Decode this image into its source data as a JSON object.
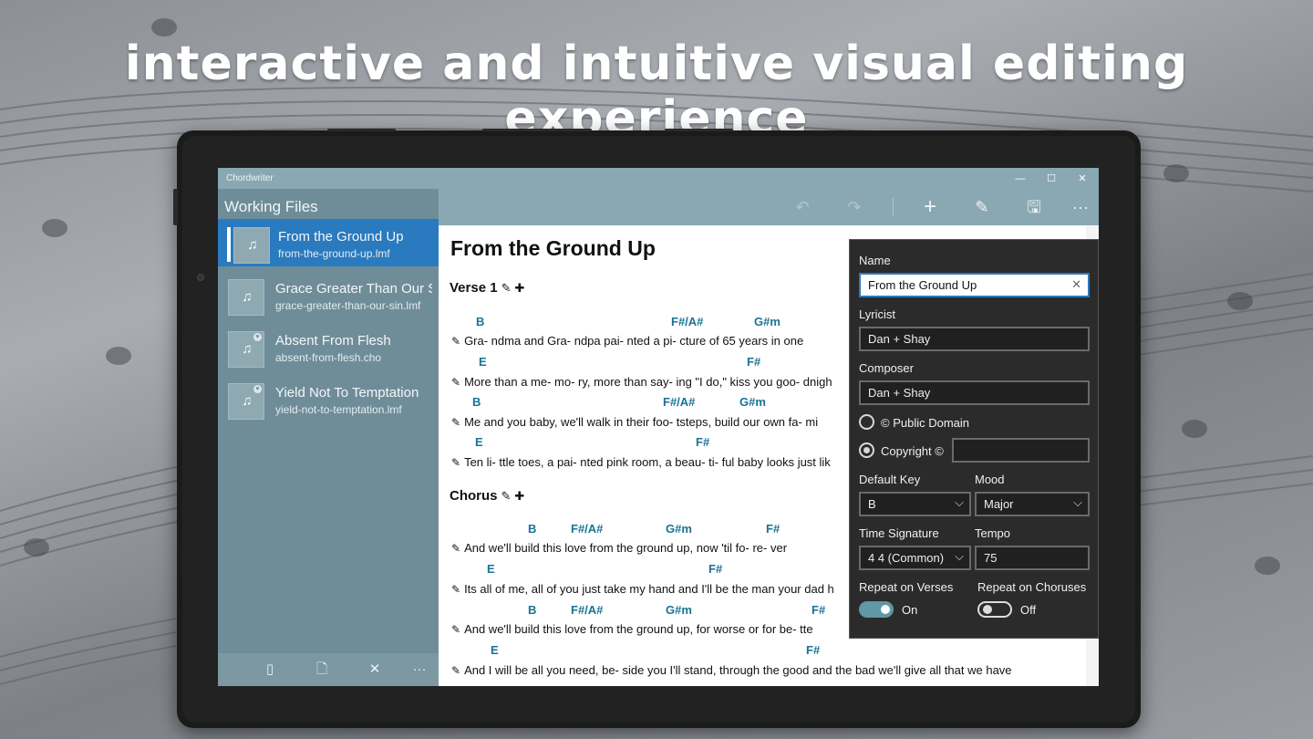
{
  "headline": "interactive and intuitive visual editing experience",
  "window": {
    "title": "Chordwriter",
    "minimize": "—",
    "maximize": "☐",
    "close": "✕"
  },
  "sidebar": {
    "title": "Working Files",
    "items": [
      {
        "name": "From the Ground Up",
        "path": "from-the-ground-up.lmf",
        "icon": "music-note-icon"
      },
      {
        "name": "Grace Greater Than Our Sin",
        "path": "grace-greater-than-our-sin.lmf",
        "icon": "music-note-icon"
      },
      {
        "name": "Absent From Flesh",
        "path": "absent-from-flesh.cho",
        "icon": "music-note-icon"
      },
      {
        "name": "Yield Not To Temptation",
        "path": "yield-not-to-temptation.lmf",
        "icon": "music-note-icon"
      }
    ],
    "bottom": {
      "new": "▯",
      "new_file": "🗋",
      "close": "✕",
      "more": "···"
    }
  },
  "toolbar": {
    "undo": "↶",
    "redo": "↷",
    "add": "+",
    "edit": "✎",
    "save": "🖫",
    "more": "···"
  },
  "song": {
    "title": "From the Ground Up",
    "sections": [
      {
        "name": "Verse 1",
        "edit": "✎",
        "add": "✚"
      },
      {
        "name": "Chorus",
        "edit": "✎",
        "add": "✚"
      }
    ],
    "lines": [
      {
        "chords": [
          "B",
          "F#/A#",
          "G#m"
        ],
        "lyric": "Gra- ndma and Gra- ndpa pai- nted a pi-       cture of 65        years in one"
      },
      {
        "chords": [
          "E",
          "F#"
        ],
        "lyric": "More than a me- mo- ry, more than say- ing \"I do,\" kiss you goo- dnigh"
      },
      {
        "chords": [
          "B",
          "F#/A#",
          "G#m"
        ],
        "lyric": "Me and you baby, we'll walk in their foo-       tsteps, build our own fa- mi"
      },
      {
        "chords": [
          "E",
          "F#"
        ],
        "lyric": "Ten li- ttle toes, a pai- nted pink room, a beau- ti- ful baby looks just lik"
      },
      {
        "chords": [
          "B",
          "F#/A#",
          "G#m",
          "F#"
        ],
        "lyric": "And we'll build this love       from the ground up, now 'til fo- re- ver"
      },
      {
        "chords": [
          "E",
          "F#"
        ],
        "lyric": "Its all of me, all of you just take my hand and I'll  be the man your dad h"
      },
      {
        "chords": [
          "B",
          "F#/A#",
          "G#m",
          "F#"
        ],
        "lyric": "And we'll build this love       from the ground up, for worse or for be- tte"
      },
      {
        "chords": [
          "E",
          "F#"
        ],
        "lyric": "And I  will be all you need, be- side you I'll stand, through the good and the bad we'll give all that we have"
      }
    ]
  },
  "properties": {
    "name_label": "Name",
    "name_value": "From the Ground Up",
    "clear": "✕",
    "lyricist_label": "Lyricist",
    "lyricist_value": "Dan + Shay",
    "composer_label": "Composer",
    "composer_value": "Dan + Shay",
    "public_domain": "© Public Domain",
    "copyright": "Copyright ©",
    "copyright_value": "",
    "key_label": "Default Key",
    "key_value": "B",
    "mood_label": "Mood",
    "mood_value": "Major",
    "time_label": "Time Signature",
    "time_value": "4 4 (Common)",
    "tempo_label": "Tempo",
    "tempo_value": "75",
    "repeat_verses_label": "Repeat on Verses",
    "repeat_verses_state": "On",
    "repeat_choruses_label": "Repeat on Choruses",
    "repeat_choruses_state": "Off",
    "chevron": "⌵"
  },
  "colors": {
    "accent": "#2a7abf",
    "chord": "#1a7394",
    "chrome": "#8aa8b3",
    "sidebar": "#6f8d99"
  }
}
